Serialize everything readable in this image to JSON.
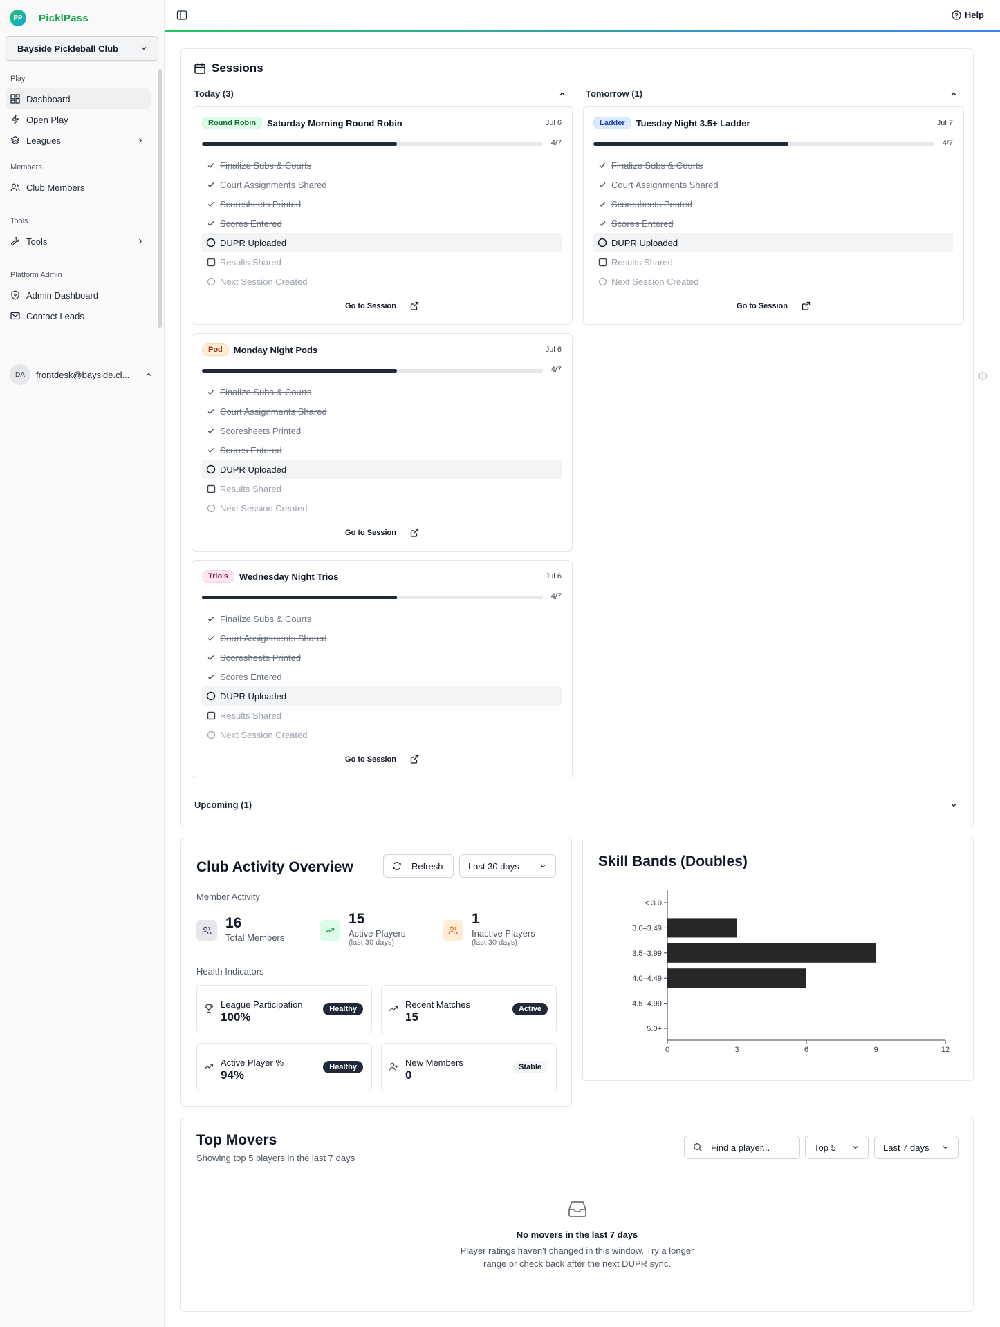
{
  "app": {
    "logo_initials": "PP",
    "name": "PicklPass"
  },
  "club_selector": {
    "value": "Bayside Pickleball Club"
  },
  "sidebar": {
    "sections": [
      {
        "title": "Play",
        "items": [
          {
            "label": "Dashboard",
            "icon": "dashboard-icon",
            "active": true
          },
          {
            "label": "Open Play",
            "icon": "lightning-icon"
          },
          {
            "label": "Leagues",
            "icon": "layers-icon",
            "chevron": true
          }
        ]
      },
      {
        "title": "Members",
        "items": [
          {
            "label": "Club Members",
            "icon": "users-icon"
          }
        ]
      },
      {
        "title": "Tools",
        "items": [
          {
            "label": "Tools",
            "icon": "wrench-icon",
            "chevron": true
          }
        ]
      },
      {
        "title": "Platform Admin",
        "items": [
          {
            "label": "Admin Dashboard",
            "icon": "shield-icon"
          },
          {
            "label": "Contact Leads",
            "icon": "mail-icon"
          }
        ]
      }
    ],
    "user": {
      "initials": "DA",
      "email": "frontdesk@bayside.cl..."
    }
  },
  "topbar": {
    "help_label": "Help"
  },
  "sessions": {
    "title": "Sessions",
    "today_label": "Today (3)",
    "tomorrow_label": "Tomorrow (1)",
    "upcoming_label": "Upcoming (1)",
    "goto_label": "Go to Session",
    "task_labels": [
      "Finalize Subs & Courts",
      "Court Assignments Shared",
      "Scoresheets Printed",
      "Scores Entered",
      "DUPR Uploaded",
      "Results Shared",
      "Next Session Created"
    ],
    "cards": [
      {
        "badge": "Round Robin",
        "title": "Saturday Morning Round Robin",
        "date": "Jul 6",
        "progress": "4/7"
      },
      {
        "badge": "Ladder",
        "title": "Tuesday Night 3.5+ Ladder",
        "date": "Jul 7",
        "progress": "4/7"
      },
      {
        "badge": "Pod",
        "title": "Monday Night Pods",
        "date": "Jul 6",
        "progress": "4/7"
      },
      {
        "badge": "Trio's",
        "title": "Wednesday Night Trios",
        "date": "Jul 6",
        "progress": "4/7"
      }
    ]
  },
  "activity": {
    "title": "Club Activity Overview",
    "refresh_label": "Refresh",
    "range": "Last 30 days",
    "member_activity_label": "Member Activity",
    "stats": [
      {
        "value": "16",
        "label": "Total Members",
        "sub": ""
      },
      {
        "value": "15",
        "label": "Active Players",
        "sub": "(last 30 days)"
      },
      {
        "value": "1",
        "label": "Inactive Players",
        "sub": "(last 30 days)"
      }
    ],
    "health_label": "Health Indicators",
    "indicators": [
      {
        "label": "League Participation",
        "value": "100%",
        "status": "Healthy"
      },
      {
        "label": "Recent Matches",
        "value": "15",
        "status": "Active"
      },
      {
        "label": "Active Player %",
        "value": "94%",
        "status": "Healthy"
      },
      {
        "label": "New Members",
        "value": "0",
        "status": "Stable"
      }
    ]
  },
  "chart_data": {
    "type": "bar",
    "orientation": "horizontal",
    "title": "Skill Bands (Doubles)",
    "categories": [
      "< 3.0",
      "3.0–3.49",
      "3.5–3.99",
      "4.0–4.49",
      "4.5–4.99",
      "5.0+"
    ],
    "values": [
      0,
      3,
      9,
      6,
      0,
      0
    ],
    "xlim": [
      0,
      12
    ],
    "xticks": [
      "0",
      "3",
      "6",
      "9",
      "12"
    ],
    "bar_color": "#27272a"
  },
  "movers": {
    "title": "Top Movers",
    "subtitle": "Showing top 5 players in the last 7 days",
    "search_placeholder": "Find a player...",
    "top_select": "Top 5",
    "range_select": "Last 7 days",
    "empty_title": "No movers in the last 7 days",
    "empty_text": "Player ratings haven't changed in this window. Try a longer range or check back after the next DUPR sync."
  }
}
